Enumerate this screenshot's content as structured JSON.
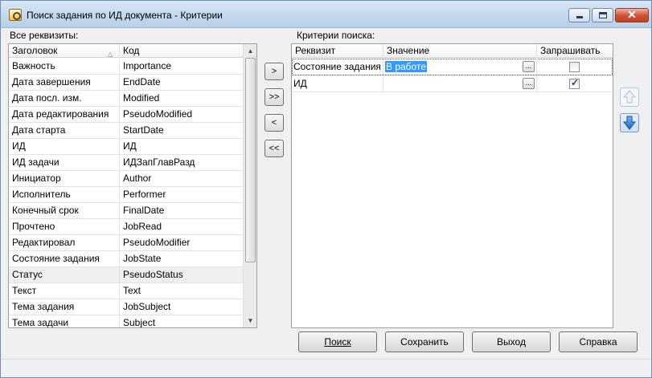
{
  "window": {
    "title": "Поиск задания по ИД документа - Критерии",
    "controls": {
      "minimize": "minimize",
      "maximize": "maximize",
      "close": "✕"
    }
  },
  "left_panel": {
    "label": "Все реквизиты:",
    "columns": [
      "Заголовок",
      "Код"
    ],
    "rows": [
      [
        "Важность",
        "Importance"
      ],
      [
        "Дата завершения",
        "EndDate"
      ],
      [
        "Дата посл. изм.",
        "Modified"
      ],
      [
        "Дата редактирования",
        "PseudoModified"
      ],
      [
        "Дата старта",
        "StartDate"
      ],
      [
        "ИД",
        "ИД"
      ],
      [
        "ИД задачи",
        "ИДЗапГлавРазд"
      ],
      [
        "Инициатор",
        "Author"
      ],
      [
        "Исполнитель",
        "Performer"
      ],
      [
        "Конечный срок",
        "FinalDate"
      ],
      [
        "Прочтено",
        "JobRead"
      ],
      [
        "Редактировал",
        "PseudoModifier"
      ],
      [
        "Состояние задания",
        "JobState"
      ],
      [
        "Статус",
        "PseudoStatus"
      ],
      [
        "Текст",
        "Text"
      ],
      [
        "Тема задания",
        "JobSubject"
      ],
      [
        "Тема задачи",
        "Subject"
      ]
    ],
    "selected_row_index": 13
  },
  "transfer_buttons": {
    "add": ">",
    "add_all": ">>",
    "remove": "<",
    "remove_all": "<<"
  },
  "right_panel": {
    "label": "Критерии поиска:",
    "columns": [
      "Реквизит",
      "Значение",
      "Запрашивать"
    ],
    "rows": [
      {
        "field": "Состояние задания",
        "value": "В работе",
        "ask": false
      },
      {
        "field": "ИД",
        "value": "",
        "ask": true
      }
    ],
    "ellipsis": "..."
  },
  "buttons": {
    "search": "Поиск",
    "save": "Сохранить",
    "exit": "Выход",
    "help": "Справка"
  }
}
